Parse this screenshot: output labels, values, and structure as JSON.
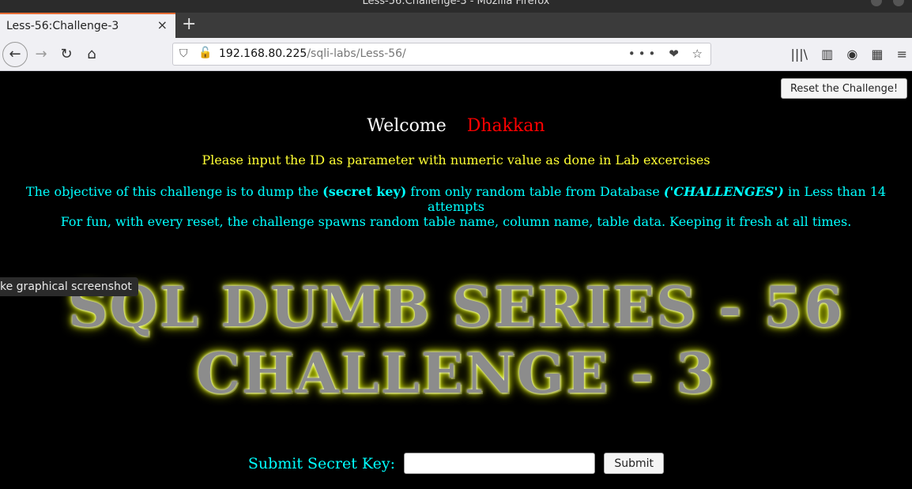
{
  "window": {
    "title": "Less-56:Challenge-3 - Mozilla Firefox"
  },
  "tabs": [
    {
      "label": "Less-56:Challenge-3",
      "close_icon": "×"
    }
  ],
  "new_tab_icon": "+",
  "nav": {
    "back_icon": "←",
    "forward_icon": "→",
    "reload_icon": "↻",
    "home_icon": "⌂"
  },
  "urlbar": {
    "shield_icon": "⛉",
    "insecure_icon": "🔓",
    "host": "192.168.80.225",
    "path": "/sqli-labs/Less-56/",
    "more_icon": "•••",
    "pocket_icon": "❤",
    "bookmark_icon": "☆"
  },
  "toolbar_right": {
    "library_icon": "|||\\",
    "sidebar_icon": "▥",
    "account_icon": "◉",
    "extensions_icon": "▦",
    "menu_icon": "≡"
  },
  "page": {
    "reset_label": "Reset the Challenge!",
    "welcome": "Welcome",
    "user": "Dhakkan",
    "instruction": "Please input the ID as parameter with numeric value as done in Lab excercises",
    "objective_pre": "The objective of this challenge is to dump the ",
    "objective_key": "(secret key)",
    "objective_mid": " from only random table from Database ",
    "objective_db": "('CHALLENGES')",
    "objective_post": " in Less than 14 attempts",
    "fun": "For fun, with every reset, the challenge spawns random table name, column name, table data. Keeping it fresh at all times.",
    "banner_line1": "SQL DUMB SERIES - 56",
    "banner_line2": "CHALLENGE - 3",
    "submit_label": "Submit Secret Key:",
    "submit_button": "Submit",
    "key_value": ""
  },
  "tooltip": "ke graphical screenshot",
  "colors": {
    "background": "#000000",
    "welcome": "#ffffff",
    "user": "#ff0000",
    "instruction": "#ffff33",
    "objective": "#00ffff",
    "banner_glow": "#eaff00"
  }
}
